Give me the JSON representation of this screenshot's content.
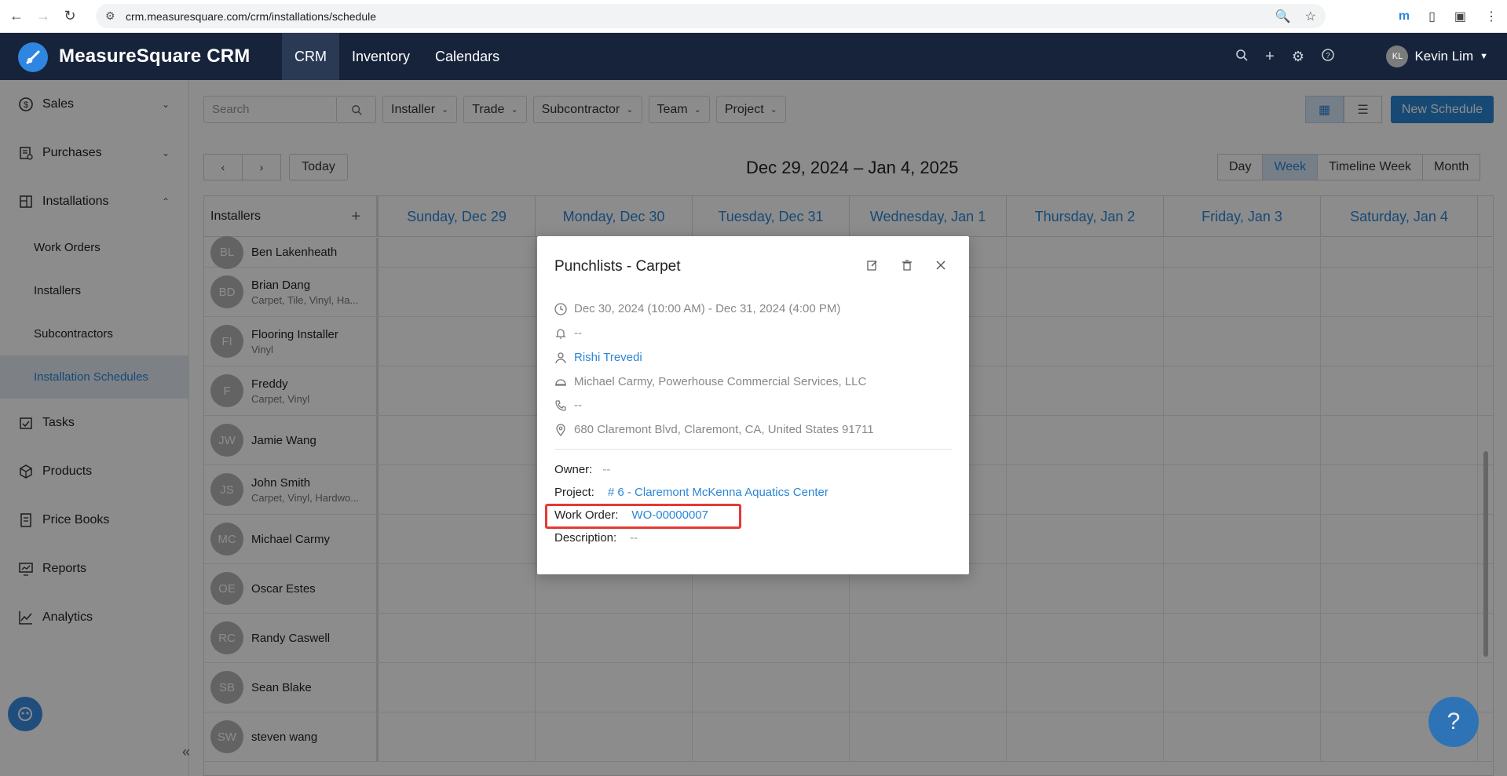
{
  "browser": {
    "url": "crm.measuresquare.com/crm/installations/schedule"
  },
  "app": {
    "brand": "MeasureSquare CRM",
    "topnav": [
      {
        "label": "CRM"
      },
      {
        "label": "Inventory"
      },
      {
        "label": "Calendars"
      }
    ],
    "user": {
      "initials": "KL",
      "name": "Kevin Lim"
    }
  },
  "sidebar": {
    "items": [
      {
        "label": "Sales",
        "icon": "dollar-icon"
      },
      {
        "label": "Purchases",
        "icon": "purchases-icon"
      },
      {
        "label": "Installations",
        "icon": "installations-icon"
      }
    ],
    "sub_items": [
      {
        "label": "Work Orders"
      },
      {
        "label": "Installers"
      },
      {
        "label": "Subcontractors"
      },
      {
        "label": "Installation Schedules"
      }
    ],
    "items2": [
      {
        "label": "Tasks",
        "icon": "tasks-icon"
      },
      {
        "label": "Products",
        "icon": "products-icon"
      },
      {
        "label": "Price Books",
        "icon": "price-books-icon"
      },
      {
        "label": "Reports",
        "icon": "reports-icon"
      },
      {
        "label": "Analytics",
        "icon": "analytics-icon"
      }
    ]
  },
  "toolbar": {
    "search_placeholder": "Search",
    "filters": [
      "Installer",
      "Trade",
      "Subcontractor",
      "Team",
      "Project"
    ],
    "new_button": "New Schedule",
    "today": "Today",
    "date_range": "Dec 29, 2024 – Jan 4, 2025",
    "ranges": [
      "Day",
      "Week",
      "Timeline Week",
      "Month"
    ]
  },
  "grid": {
    "installers_header": "Installers",
    "days": [
      "Sunday, Dec 29",
      "Monday, Dec 30",
      "Tuesday, Dec 31",
      "Wednesday, Jan 1",
      "Thursday, Jan 2",
      "Friday, Jan 3",
      "Saturday, Jan 4"
    ],
    "installers": [
      {
        "initials": "BL",
        "name": "Ben Lakenheath",
        "sub": ""
      },
      {
        "initials": "BD",
        "name": "Brian Dang",
        "sub": "Carpet, Tile, Vinyl, Ha..."
      },
      {
        "initials": "FI",
        "name": "Flooring Installer",
        "sub": "Vinyl"
      },
      {
        "initials": "F",
        "name": "Freddy",
        "sub": "Carpet, Vinyl"
      },
      {
        "initials": "JW",
        "name": "Jamie Wang",
        "sub": ""
      },
      {
        "initials": "JS",
        "name": "John Smith",
        "sub": "Carpet, Vinyl, Hardwo..."
      },
      {
        "initials": "MC",
        "name": "Michael Carmy",
        "sub": ""
      },
      {
        "initials": "OE",
        "name": "Oscar Estes",
        "sub": ""
      },
      {
        "initials": "RC",
        "name": "Randy Caswell",
        "sub": ""
      },
      {
        "initials": "SB",
        "name": "Sean Blake",
        "sub": ""
      },
      {
        "initials": "SW",
        "name": "steven wang",
        "sub": ""
      }
    ]
  },
  "modal": {
    "title": "Punchlists - Carpet",
    "datetime": "Dec 30, 2024 (10:00 AM) - Dec 31, 2024 (4:00 PM)",
    "reminder": "--",
    "assignee": "Rishi Trevedi",
    "installer": "Michael Carmy, Powerhouse Commercial Services, LLC",
    "phone": "--",
    "address": "680 Claremont Blvd, Claremont, CA, United States 91711",
    "owner_label": "Owner:",
    "owner_value": "--",
    "project_label": "Project:",
    "project_value": "# 6 - Claremont McKenna Aquatics Center",
    "work_order_label": "Work Order:",
    "work_order_value": "WO-00000007",
    "description_label": "Description:",
    "description_value": "--"
  }
}
